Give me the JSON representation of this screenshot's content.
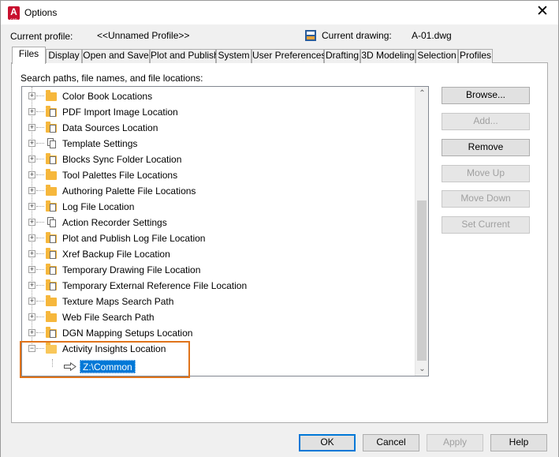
{
  "window": {
    "title": "Options",
    "close_icon": "close-icon",
    "app_icon_letter": "A",
    "app_icon_sub": "CAD"
  },
  "header": {
    "current_profile_label": "Current profile:",
    "current_profile_value": "<<Unnamed Profile>>",
    "current_drawing_label": "Current drawing:",
    "current_drawing_value": "A-01.dwg"
  },
  "tabs": [
    {
      "label": "Files",
      "active": true
    },
    {
      "label": "Display"
    },
    {
      "label": "Open and Save"
    },
    {
      "label": "Plot and Publish"
    },
    {
      "label": "System"
    },
    {
      "label": "User Preferences"
    },
    {
      "label": "Drafting"
    },
    {
      "label": "3D Modeling"
    },
    {
      "label": "Selection"
    },
    {
      "label": "Profiles"
    }
  ],
  "files": {
    "section_label": "Search paths, file names, and file locations:",
    "tree_items": [
      {
        "label": "Color Book Locations",
        "icon": "folder"
      },
      {
        "label": "PDF Import Image Location",
        "icon": "folder-doc"
      },
      {
        "label": "Data Sources Location",
        "icon": "folder-doc"
      },
      {
        "label": "Template Settings",
        "icon": "docs"
      },
      {
        "label": "Blocks Sync Folder Location",
        "icon": "folder-doc"
      },
      {
        "label": "Tool Palettes File Locations",
        "icon": "folder"
      },
      {
        "label": "Authoring Palette File Locations",
        "icon": "folder"
      },
      {
        "label": "Log File Location",
        "icon": "folder-doc"
      },
      {
        "label": "Action Recorder Settings",
        "icon": "docs"
      },
      {
        "label": "Plot and Publish Log File Location",
        "icon": "folder-doc"
      },
      {
        "label": "Xref Backup File Location",
        "icon": "folder-doc"
      },
      {
        "label": "Temporary Drawing File Location",
        "icon": "folder-doc"
      },
      {
        "label": "Temporary External Reference File Location",
        "icon": "folder-doc"
      },
      {
        "label": "Texture Maps Search Path",
        "icon": "folder"
      },
      {
        "label": "Web File Search Path",
        "icon": "folder"
      },
      {
        "label": "DGN Mapping Setups Location",
        "icon": "folder-doc"
      },
      {
        "label": "Activity Insights Location",
        "icon": "folder-open",
        "expanded": true
      }
    ],
    "selected_child": "Z:\\Common",
    "buttons": {
      "browse": "Browse...",
      "add": "Add...",
      "remove": "Remove",
      "move_up": "Move Up",
      "move_down": "Move Down",
      "set_current": "Set Current"
    }
  },
  "footer": {
    "ok": "OK",
    "cancel": "Cancel",
    "apply": "Apply",
    "help": "Help"
  },
  "colors": {
    "highlight_box": "#e0741b",
    "selection": "#0078d7",
    "folder": "#f6b73c"
  }
}
